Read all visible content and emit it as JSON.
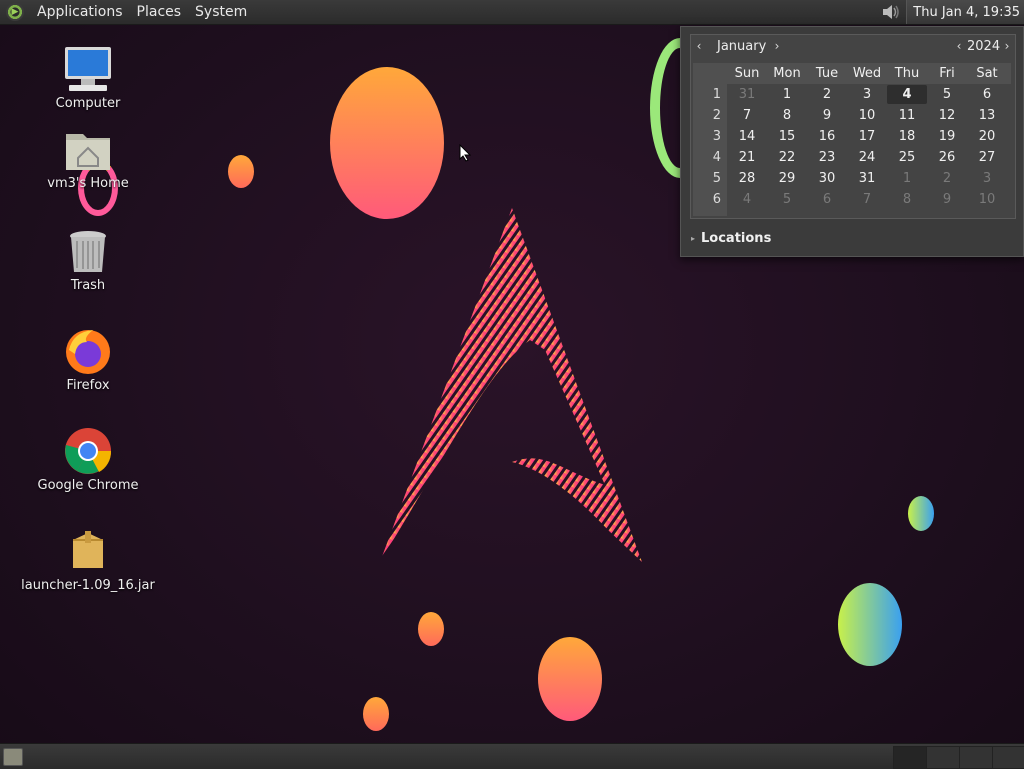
{
  "top_panel": {
    "menus": [
      "Applications",
      "Places",
      "System"
    ],
    "clock": "Thu Jan  4, 19:35"
  },
  "desktop_icons": [
    {
      "label": "Computer",
      "icon": "computer-icon"
    },
    {
      "label": "vm3's Home",
      "icon": "home-folder-icon"
    },
    {
      "label": "Trash",
      "icon": "trash-icon"
    },
    {
      "label": "Firefox",
      "icon": "firefox-icon"
    },
    {
      "label": "Google Chrome",
      "icon": "chrome-icon"
    },
    {
      "label": "launcher-1.09_16.jar",
      "icon": "jar-package-icon"
    }
  ],
  "calendar": {
    "month": "January",
    "year": "2024",
    "weekday_headers": [
      "Sun",
      "Mon",
      "Tue",
      "Wed",
      "Thu",
      "Fri",
      "Sat"
    ],
    "weeks": [
      {
        "num": "1",
        "days": [
          "31",
          "1",
          "2",
          "3",
          "4",
          "5",
          "6"
        ]
      },
      {
        "num": "2",
        "days": [
          "7",
          "8",
          "9",
          "10",
          "11",
          "12",
          "13"
        ]
      },
      {
        "num": "3",
        "days": [
          "14",
          "15",
          "16",
          "17",
          "18",
          "19",
          "20"
        ]
      },
      {
        "num": "4",
        "days": [
          "21",
          "22",
          "23",
          "24",
          "25",
          "26",
          "27"
        ]
      },
      {
        "num": "5",
        "days": [
          "28",
          "29",
          "30",
          "31",
          "1",
          "2",
          "3"
        ]
      },
      {
        "num": "6",
        "days": [
          "4",
          "5",
          "6",
          "7",
          "8",
          "9",
          "10"
        ]
      }
    ],
    "today": "4",
    "locations_label": "Locations"
  },
  "colors": {
    "panel": "#2f2f2f",
    "accent_green": "#7fb04a",
    "wallpaper": "#1f0f1f"
  }
}
